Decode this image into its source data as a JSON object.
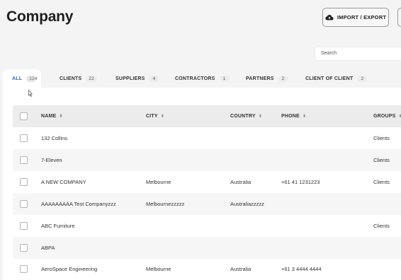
{
  "header": {
    "title": "Company",
    "import_export_label": "IMPORT / EXPORT"
  },
  "search": {
    "placeholder": "Search"
  },
  "tabs": [
    {
      "label": "ALL",
      "count": "124"
    },
    {
      "label": "CLIENTS",
      "count": "22"
    },
    {
      "label": "SUPPLIERS",
      "count": "4"
    },
    {
      "label": "CONTRACTORS",
      "count": "1"
    },
    {
      "label": "PARTNERS",
      "count": "2"
    },
    {
      "label": "CLIENT OF CLIENT",
      "count": "2"
    }
  ],
  "table": {
    "columns": {
      "name": "NAME",
      "city": "CITY",
      "country": "COUNTRY",
      "phone": "PHONE",
      "groups": "GROUPS"
    },
    "rows": [
      {
        "name": "132 Collins",
        "city": "",
        "country": "",
        "phone": "",
        "groups": "Clients"
      },
      {
        "name": "7-Eleven",
        "city": "",
        "country": "",
        "phone": "",
        "groups": "Clients"
      },
      {
        "name": "A NEW COMPANY",
        "city": "Melbourne",
        "country": "Australia",
        "phone": "+61 41 1231223",
        "groups": "Clients"
      },
      {
        "name": "AAAAAAAAA Test Companyzzz",
        "city": "Melbournezzzzz",
        "country": "Australiazzzzz",
        "phone": "",
        "groups": ""
      },
      {
        "name": "ABC Furniture",
        "city": "",
        "country": "",
        "phone": "",
        "groups": "Clients"
      },
      {
        "name": "ABPA",
        "city": "",
        "country": "",
        "phone": "",
        "groups": ""
      },
      {
        "name": "AeroSpace Engineering",
        "city": "Melbourne",
        "country": "Australia",
        "phone": "+61 3 4444 4444",
        "groups": ""
      }
    ]
  }
}
